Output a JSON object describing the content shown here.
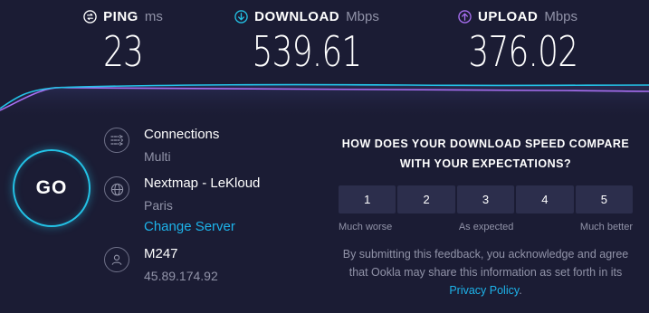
{
  "metrics": {
    "ping": {
      "label": "PING",
      "unit": "ms",
      "value": "23",
      "icon": "ping-icon"
    },
    "download": {
      "label": "DOWNLOAD",
      "unit": "Mbps",
      "value": "539.61",
      "icon": "download-arrow-icon",
      "color": "#23c2e6"
    },
    "upload": {
      "label": "UPLOAD",
      "unit": "Mbps",
      "value": "376.02",
      "icon": "upload-arrow-icon",
      "color": "#a86ff2"
    }
  },
  "go_button": {
    "label": "GO"
  },
  "connections": {
    "title": "Connections",
    "value": "Multi",
    "icon": "connections-icon"
  },
  "server": {
    "name": "Nextmap - LeKloud",
    "location": "Paris",
    "change_label": "Change Server",
    "icon": "globe-icon"
  },
  "provider": {
    "name": "M247",
    "ip": "45.89.174.92",
    "icon": "user-icon"
  },
  "survey": {
    "question": "HOW DOES YOUR DOWNLOAD SPEED COMPARE WITH YOUR EXPECTATIONS?",
    "options": [
      "1",
      "2",
      "3",
      "4",
      "5"
    ],
    "low_label": "Much worse",
    "mid_label": "As expected",
    "high_label": "Much better",
    "disclaimer_prefix": "By submitting this feedback, you acknowledge and agree that Ookla may share this information as set forth in its",
    "privacy_link": "Privacy Policy",
    "disclaimer_suffix": "."
  },
  "colors": {
    "background": "#1b1c34",
    "accent": "#23c2e6",
    "upload": "#a86ff2",
    "muted": "#9193a8"
  }
}
